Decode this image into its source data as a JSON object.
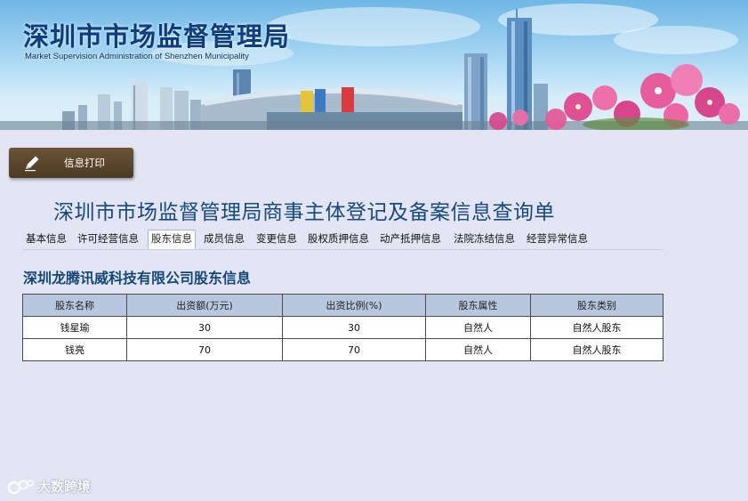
{
  "header": {
    "title": "深圳市市场监督管理局",
    "subtitle": "Market Supervision Administration of Shenzhen Municipality"
  },
  "toolbar": {
    "print_label": "信息打印",
    "print_icon": "pencil-icon"
  },
  "page": {
    "title": "深圳市市场监督管理局商事主体登记及备案信息查询单"
  },
  "tabs": [
    {
      "label": "基本信息"
    },
    {
      "label": "许可经营信息"
    },
    {
      "label": "股东信息",
      "active": true
    },
    {
      "label": "成员信息"
    },
    {
      "label": "变更信息"
    },
    {
      "label": "股权质押信息"
    },
    {
      "label": "动产抵押信息"
    },
    {
      "label": "法院冻结信息"
    },
    {
      "label": "经营异常信息"
    }
  ],
  "section": {
    "title": "深圳龙腾讯威科技有限公司股东信息"
  },
  "table": {
    "columns": [
      "股东名称",
      "出资额(万元)",
      "出资比例(%)",
      "股东属性",
      "股东类别"
    ],
    "rows": [
      [
        "钱星瑜",
        "30",
        "30",
        "自然人",
        "自然人股东"
      ],
      [
        "钱亮",
        "70",
        "70",
        "自然人",
        "自然人股东"
      ]
    ]
  },
  "watermark": {
    "text": "大数跨境"
  },
  "colors": {
    "page_background": "#e3e5f4",
    "title_blue": "#17497f",
    "header_cell": "#b7c7de",
    "print_button": "#5a4530"
  }
}
